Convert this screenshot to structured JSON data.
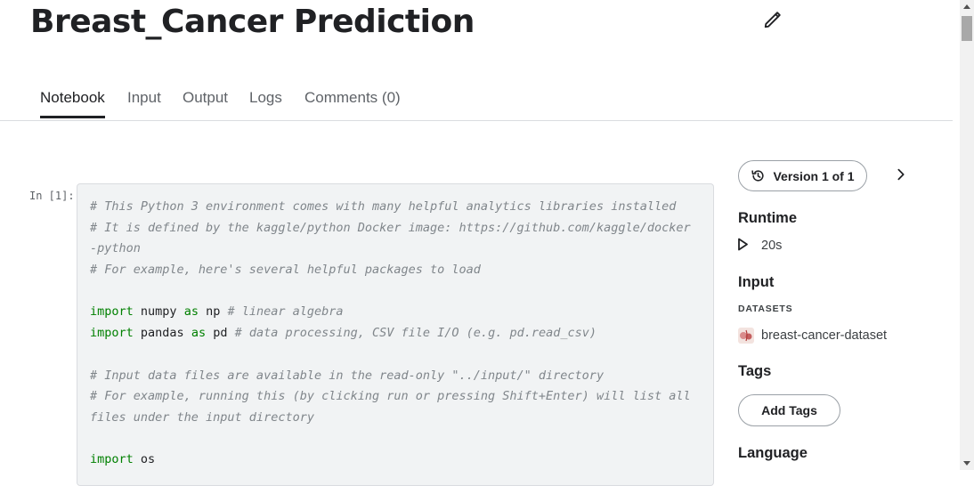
{
  "header": {
    "title": "Breast_Cancer Prediction"
  },
  "tabs": [
    {
      "label": "Notebook",
      "active": true
    },
    {
      "label": "Input"
    },
    {
      "label": "Output"
    },
    {
      "label": "Logs"
    },
    {
      "label": "Comments (0)"
    }
  ],
  "cell": {
    "prompt": "In [1]:",
    "lines": [
      {
        "comment": "# This Python 3 environment comes with many helpful analytics libraries installed"
      },
      {
        "comment": "# It is defined by the kaggle/python Docker image: https://github.com/kaggle/docker"
      },
      {
        "comment": "-python"
      },
      {
        "comment": "# For example, here's several helpful packages to load"
      },
      {},
      {
        "kw1": "import",
        "t1": " numpy ",
        "kw2": "as",
        "t2": " np ",
        "comment": "# linear algebra"
      },
      {
        "kw1": "import",
        "t1": " pandas ",
        "kw2": "as",
        "t2": " pd ",
        "comment": "# data processing, CSV file I/O (e.g. pd.read_csv)"
      },
      {},
      {
        "comment": "# Input data files are available in the read-only \"../input/\" directory"
      },
      {
        "comment": "# For example, running this (by clicking run or pressing Shift+Enter) will list all"
      },
      {
        "comment": "files under the input directory"
      },
      {},
      {
        "kw1": "import",
        "t1": " os"
      }
    ]
  },
  "sidebar": {
    "version_label": "Version 1 of 1",
    "runtime": {
      "heading": "Runtime",
      "value": "20s"
    },
    "input": {
      "heading": "Input",
      "section_label": "DATASETS",
      "dataset": "breast-cancer-dataset"
    },
    "tags": {
      "heading": "Tags",
      "button_label": "Add Tags"
    },
    "language": {
      "heading": "Language"
    }
  },
  "icons": {
    "edit": "pencil-icon",
    "version": "history-icon",
    "next": "chevron-right-icon",
    "runtime": "play-icon"
  },
  "colors": {
    "keyword": "#008000",
    "comment": "#80868b",
    "code_background": "#f1f3f4",
    "text": "#202124"
  }
}
